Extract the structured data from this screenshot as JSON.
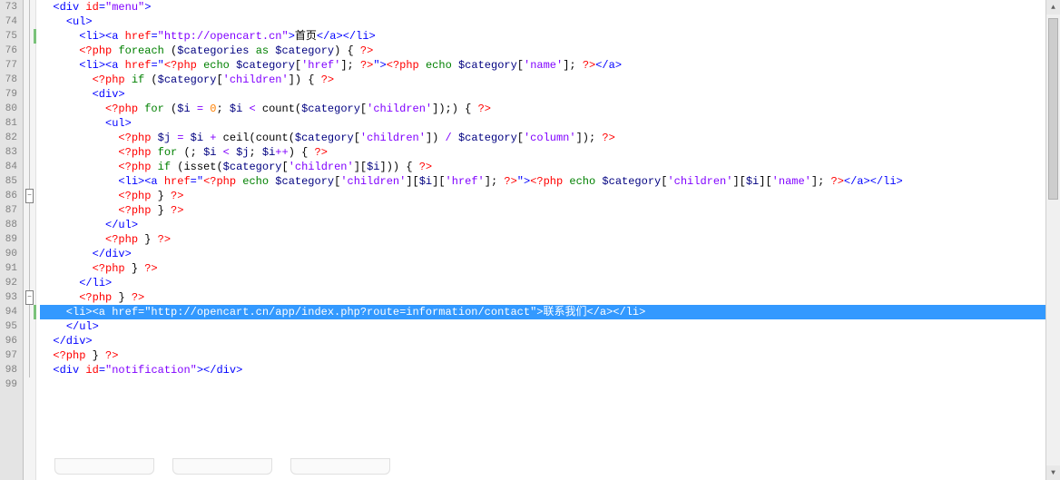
{
  "lines": [
    {
      "n": 73,
      "fold": "line",
      "bar": false,
      "sel": false,
      "tokens": [
        {
          "c": "plain",
          "t": "  "
        },
        {
          "c": "tag",
          "t": "<div "
        },
        {
          "c": "attr",
          "t": "id"
        },
        {
          "c": "tag",
          "t": "="
        },
        {
          "c": "str",
          "t": "\"menu\""
        },
        {
          "c": "tag",
          "t": ">"
        }
      ]
    },
    {
      "n": 74,
      "fold": "line",
      "bar": false,
      "sel": false,
      "tokens": [
        {
          "c": "plain",
          "t": "    "
        },
        {
          "c": "tag",
          "t": "<ul>"
        }
      ]
    },
    {
      "n": 75,
      "fold": "line",
      "bar": true,
      "sel": false,
      "tokens": [
        {
          "c": "plain",
          "t": "      "
        },
        {
          "c": "tag",
          "t": "<li><a "
        },
        {
          "c": "attr",
          "t": "href"
        },
        {
          "c": "tag",
          "t": "="
        },
        {
          "c": "str",
          "t": "\"http://opencart.cn\""
        },
        {
          "c": "tag",
          "t": ">"
        },
        {
          "c": "txt",
          "t": "首页"
        },
        {
          "c": "tag",
          "t": "</a></li>"
        }
      ]
    },
    {
      "n": 76,
      "fold": "line",
      "bar": false,
      "sel": false,
      "tokens": [
        {
          "c": "plain",
          "t": "      "
        },
        {
          "c": "phptag",
          "t": "<?php "
        },
        {
          "c": "kw",
          "t": "foreach"
        },
        {
          "c": "plain",
          "t": " ("
        },
        {
          "c": "var",
          "t": "$categories"
        },
        {
          "c": "plain",
          "t": " "
        },
        {
          "c": "kw",
          "t": "as"
        },
        {
          "c": "plain",
          "t": " "
        },
        {
          "c": "var",
          "t": "$category"
        },
        {
          "c": "plain",
          "t": ") { "
        },
        {
          "c": "phptag",
          "t": "?>"
        }
      ]
    },
    {
      "n": 77,
      "fold": "line",
      "bar": false,
      "sel": false,
      "tokens": [
        {
          "c": "plain",
          "t": "      "
        },
        {
          "c": "tag",
          "t": "<li><a "
        },
        {
          "c": "attr",
          "t": "href"
        },
        {
          "c": "tag",
          "t": "=\""
        },
        {
          "c": "phptag",
          "t": "<?php "
        },
        {
          "c": "kw",
          "t": "echo"
        },
        {
          "c": "plain",
          "t": " "
        },
        {
          "c": "var",
          "t": "$category"
        },
        {
          "c": "plain",
          "t": "["
        },
        {
          "c": "op",
          "t": "'href'"
        },
        {
          "c": "plain",
          "t": "]; "
        },
        {
          "c": "phptag",
          "t": "?>"
        },
        {
          "c": "tag",
          "t": "\">"
        },
        {
          "c": "phptag",
          "t": "<?php "
        },
        {
          "c": "kw",
          "t": "echo"
        },
        {
          "c": "plain",
          "t": " "
        },
        {
          "c": "var",
          "t": "$category"
        },
        {
          "c": "plain",
          "t": "["
        },
        {
          "c": "op",
          "t": "'name'"
        },
        {
          "c": "plain",
          "t": "]; "
        },
        {
          "c": "phptag",
          "t": "?>"
        },
        {
          "c": "tag",
          "t": "</a>"
        }
      ]
    },
    {
      "n": 78,
      "fold": "line",
      "bar": false,
      "sel": false,
      "tokens": [
        {
          "c": "plain",
          "t": "        "
        },
        {
          "c": "phptag",
          "t": "<?php "
        },
        {
          "c": "kw",
          "t": "if"
        },
        {
          "c": "plain",
          "t": " ("
        },
        {
          "c": "var",
          "t": "$category"
        },
        {
          "c": "plain",
          "t": "["
        },
        {
          "c": "op",
          "t": "'children'"
        },
        {
          "c": "plain",
          "t": "]) { "
        },
        {
          "c": "phptag",
          "t": "?>"
        }
      ]
    },
    {
      "n": 79,
      "fold": "line",
      "bar": false,
      "sel": false,
      "tokens": [
        {
          "c": "plain",
          "t": "        "
        },
        {
          "c": "tag",
          "t": "<div>"
        }
      ]
    },
    {
      "n": 80,
      "fold": "line",
      "bar": false,
      "sel": false,
      "tokens": [
        {
          "c": "plain",
          "t": "          "
        },
        {
          "c": "phptag",
          "t": "<?php "
        },
        {
          "c": "kw",
          "t": "for"
        },
        {
          "c": "plain",
          "t": " ("
        },
        {
          "c": "var",
          "t": "$i"
        },
        {
          "c": "plain",
          "t": " "
        },
        {
          "c": "op",
          "t": "="
        },
        {
          "c": "plain",
          "t": " "
        },
        {
          "c": "num",
          "t": "0"
        },
        {
          "c": "plain",
          "t": "; "
        },
        {
          "c": "var",
          "t": "$i"
        },
        {
          "c": "plain",
          "t": " "
        },
        {
          "c": "op",
          "t": "<"
        },
        {
          "c": "plain",
          "t": " "
        },
        {
          "c": "func",
          "t": "count"
        },
        {
          "c": "plain",
          "t": "("
        },
        {
          "c": "var",
          "t": "$category"
        },
        {
          "c": "plain",
          "t": "["
        },
        {
          "c": "op",
          "t": "'children'"
        },
        {
          "c": "plain",
          "t": "]);) { "
        },
        {
          "c": "phptag",
          "t": "?>"
        }
      ]
    },
    {
      "n": 81,
      "fold": "line",
      "bar": false,
      "sel": false,
      "tokens": [
        {
          "c": "plain",
          "t": "          "
        },
        {
          "c": "tag",
          "t": "<ul>"
        }
      ]
    },
    {
      "n": 82,
      "fold": "line",
      "bar": false,
      "sel": false,
      "tokens": [
        {
          "c": "plain",
          "t": "            "
        },
        {
          "c": "phptag",
          "t": "<?php "
        },
        {
          "c": "var",
          "t": "$j"
        },
        {
          "c": "plain",
          "t": " "
        },
        {
          "c": "op",
          "t": "="
        },
        {
          "c": "plain",
          "t": " "
        },
        {
          "c": "var",
          "t": "$i"
        },
        {
          "c": "plain",
          "t": " "
        },
        {
          "c": "op",
          "t": "+"
        },
        {
          "c": "plain",
          "t": " "
        },
        {
          "c": "func",
          "t": "ceil"
        },
        {
          "c": "plain",
          "t": "("
        },
        {
          "c": "func",
          "t": "count"
        },
        {
          "c": "plain",
          "t": "("
        },
        {
          "c": "var",
          "t": "$category"
        },
        {
          "c": "plain",
          "t": "["
        },
        {
          "c": "op",
          "t": "'children'"
        },
        {
          "c": "plain",
          "t": "]) "
        },
        {
          "c": "op",
          "t": "/"
        },
        {
          "c": "plain",
          "t": " "
        },
        {
          "c": "var",
          "t": "$category"
        },
        {
          "c": "plain",
          "t": "["
        },
        {
          "c": "op",
          "t": "'column'"
        },
        {
          "c": "plain",
          "t": "]); "
        },
        {
          "c": "phptag",
          "t": "?>"
        }
      ]
    },
    {
      "n": 83,
      "fold": "line",
      "bar": false,
      "sel": false,
      "tokens": [
        {
          "c": "plain",
          "t": "            "
        },
        {
          "c": "phptag",
          "t": "<?php "
        },
        {
          "c": "kw",
          "t": "for"
        },
        {
          "c": "plain",
          "t": " (; "
        },
        {
          "c": "var",
          "t": "$i"
        },
        {
          "c": "plain",
          "t": " "
        },
        {
          "c": "op",
          "t": "<"
        },
        {
          "c": "plain",
          "t": " "
        },
        {
          "c": "var",
          "t": "$j"
        },
        {
          "c": "plain",
          "t": "; "
        },
        {
          "c": "var",
          "t": "$i"
        },
        {
          "c": "op",
          "t": "++"
        },
        {
          "c": "plain",
          "t": ") { "
        },
        {
          "c": "phptag",
          "t": "?>"
        }
      ]
    },
    {
      "n": 84,
      "fold": "line",
      "bar": false,
      "sel": false,
      "tokens": [
        {
          "c": "plain",
          "t": "            "
        },
        {
          "c": "phptag",
          "t": "<?php "
        },
        {
          "c": "kw",
          "t": "if"
        },
        {
          "c": "plain",
          "t": " ("
        },
        {
          "c": "func",
          "t": "isset"
        },
        {
          "c": "plain",
          "t": "("
        },
        {
          "c": "var",
          "t": "$category"
        },
        {
          "c": "plain",
          "t": "["
        },
        {
          "c": "op",
          "t": "'children'"
        },
        {
          "c": "plain",
          "t": "]["
        },
        {
          "c": "var",
          "t": "$i"
        },
        {
          "c": "plain",
          "t": "])) { "
        },
        {
          "c": "phptag",
          "t": "?>"
        }
      ]
    },
    {
      "n": 85,
      "fold": "line",
      "bar": false,
      "sel": false,
      "tokens": [
        {
          "c": "plain",
          "t": "            "
        },
        {
          "c": "tag",
          "t": "<li><a "
        },
        {
          "c": "attr",
          "t": "href"
        },
        {
          "c": "tag",
          "t": "=\""
        },
        {
          "c": "phptag",
          "t": "<?php "
        },
        {
          "c": "kw",
          "t": "echo"
        },
        {
          "c": "plain",
          "t": " "
        },
        {
          "c": "var",
          "t": "$category"
        },
        {
          "c": "plain",
          "t": "["
        },
        {
          "c": "op",
          "t": "'children'"
        },
        {
          "c": "plain",
          "t": "]["
        },
        {
          "c": "var",
          "t": "$i"
        },
        {
          "c": "plain",
          "t": "]["
        },
        {
          "c": "op",
          "t": "'href'"
        },
        {
          "c": "plain",
          "t": "]; "
        },
        {
          "c": "phptag",
          "t": "?>"
        },
        {
          "c": "tag",
          "t": "\">"
        },
        {
          "c": "phptag",
          "t": "<?php "
        },
        {
          "c": "kw",
          "t": "echo"
        },
        {
          "c": "plain",
          "t": " "
        },
        {
          "c": "var",
          "t": "$category"
        },
        {
          "c": "plain",
          "t": "["
        },
        {
          "c": "op",
          "t": "'children'"
        },
        {
          "c": "plain",
          "t": "]["
        },
        {
          "c": "var",
          "t": "$i"
        },
        {
          "c": "plain",
          "t": "]["
        },
        {
          "c": "op",
          "t": "'name'"
        },
        {
          "c": "plain",
          "t": "]; "
        },
        {
          "c": "phptag",
          "t": "?>"
        },
        {
          "c": "tag",
          "t": "</a></li>"
        }
      ]
    },
    {
      "n": 86,
      "fold": "box",
      "bar": false,
      "sel": false,
      "tokens": [
        {
          "c": "plain",
          "t": "            "
        },
        {
          "c": "phptag",
          "t": "<?php "
        },
        {
          "c": "plain",
          "t": "} "
        },
        {
          "c": "phptag",
          "t": "?>"
        }
      ]
    },
    {
      "n": 87,
      "fold": "line",
      "bar": false,
      "sel": false,
      "tokens": [
        {
          "c": "plain",
          "t": "            "
        },
        {
          "c": "phptag",
          "t": "<?php "
        },
        {
          "c": "plain",
          "t": "} "
        },
        {
          "c": "phptag",
          "t": "?>"
        }
      ]
    },
    {
      "n": 88,
      "fold": "line",
      "bar": false,
      "sel": false,
      "tokens": [
        {
          "c": "plain",
          "t": "          "
        },
        {
          "c": "tag",
          "t": "</ul>"
        }
      ]
    },
    {
      "n": 89,
      "fold": "line",
      "bar": false,
      "sel": false,
      "tokens": [
        {
          "c": "plain",
          "t": "          "
        },
        {
          "c": "phptag",
          "t": "<?php "
        },
        {
          "c": "plain",
          "t": "} "
        },
        {
          "c": "phptag",
          "t": "?>"
        }
      ]
    },
    {
      "n": 90,
      "fold": "line",
      "bar": false,
      "sel": false,
      "tokens": [
        {
          "c": "plain",
          "t": "        "
        },
        {
          "c": "tag",
          "t": "</div>"
        }
      ]
    },
    {
      "n": 91,
      "fold": "line",
      "bar": false,
      "sel": false,
      "tokens": [
        {
          "c": "plain",
          "t": "        "
        },
        {
          "c": "phptag",
          "t": "<?php "
        },
        {
          "c": "plain",
          "t": "} "
        },
        {
          "c": "phptag",
          "t": "?>"
        }
      ]
    },
    {
      "n": 92,
      "fold": "line",
      "bar": false,
      "sel": false,
      "tokens": [
        {
          "c": "plain",
          "t": "      "
        },
        {
          "c": "tag",
          "t": "</li>"
        }
      ]
    },
    {
      "n": 93,
      "fold": "box",
      "bar": false,
      "sel": false,
      "tokens": [
        {
          "c": "plain",
          "t": "      "
        },
        {
          "c": "phptag",
          "t": "<?php "
        },
        {
          "c": "plain",
          "t": "} "
        },
        {
          "c": "phptag",
          "t": "?>"
        }
      ]
    },
    {
      "n": 94,
      "fold": "line",
      "bar": true,
      "sel": true,
      "tokens": [
        {
          "c": "plain",
          "t": "    <li><a href=\"http://opencart.cn/app/index.php?route=information/contact\">联系我们</a></li>"
        }
      ]
    },
    {
      "n": 95,
      "fold": "line",
      "bar": false,
      "sel": false,
      "tokens": [
        {
          "c": "plain",
          "t": "    "
        },
        {
          "c": "tag",
          "t": "</ul>"
        }
      ]
    },
    {
      "n": 96,
      "fold": "line",
      "bar": false,
      "sel": false,
      "tokens": [
        {
          "c": "plain",
          "t": "  "
        },
        {
          "c": "tag",
          "t": "</div>"
        }
      ]
    },
    {
      "n": 97,
      "fold": "line",
      "bar": false,
      "sel": false,
      "tokens": [
        {
          "c": "plain",
          "t": "  "
        },
        {
          "c": "phptag",
          "t": "<?php "
        },
        {
          "c": "plain",
          "t": "} "
        },
        {
          "c": "phptag",
          "t": "?>"
        }
      ]
    },
    {
      "n": 98,
      "fold": "line",
      "bar": false,
      "sel": false,
      "tokens": [
        {
          "c": "plain",
          "t": "  "
        },
        {
          "c": "tag",
          "t": "<div "
        },
        {
          "c": "attr",
          "t": "id"
        },
        {
          "c": "tag",
          "t": "="
        },
        {
          "c": "str",
          "t": "\"notification\""
        },
        {
          "c": "tag",
          "t": "></div>"
        }
      ]
    },
    {
      "n": 99,
      "fold": "",
      "bar": false,
      "sel": false,
      "tokens": []
    }
  ],
  "fold_minus": "−",
  "scroll_up": "▲",
  "scroll_down": "▼"
}
